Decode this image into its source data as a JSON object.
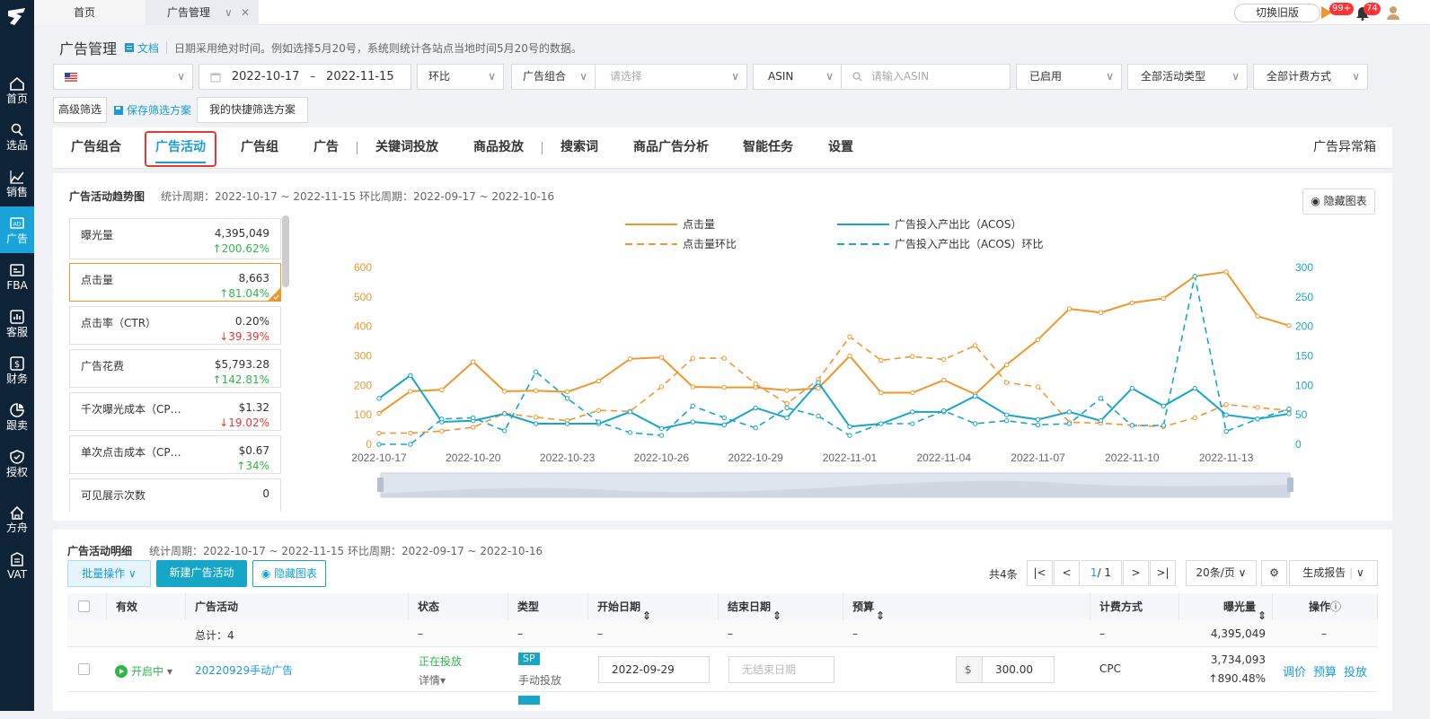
{
  "nav": {
    "items": [
      {
        "label": "首页",
        "icon": "home-icon"
      },
      {
        "label": "选品",
        "icon": "search-icon"
      },
      {
        "label": "销售",
        "icon": "trend-icon"
      },
      {
        "label": "广告",
        "icon": "ad-icon"
      },
      {
        "label": "FBA",
        "icon": "fba-icon"
      },
      {
        "label": "客服",
        "icon": "chart-icon"
      },
      {
        "label": "财务",
        "icon": "dollar-icon"
      },
      {
        "label": "跟卖",
        "icon": "pie-icon"
      },
      {
        "label": "授权",
        "icon": "shield-icon"
      },
      {
        "label": "方舟",
        "icon": "ark-icon"
      },
      {
        "label": "VAT",
        "icon": "vat-icon"
      }
    ]
  },
  "topbar": {
    "home_tab": "首页",
    "current_tab": "广告管理",
    "switch_label": "切换旧版",
    "flag_badge": "99+",
    "bell_badge": "74"
  },
  "header": {
    "title": "广告管理",
    "doc_label": "文档",
    "hint": "日期采用绝对时间。例如选择5月20号，系统则统计各站点当地时间5月20号的数据。"
  },
  "filters": {
    "date_start": "2022-10-17",
    "date_sep": "–",
    "date_end": "2022-11-15",
    "compare": "环比",
    "group_label": "广告组合",
    "group_placeholder": "请选择",
    "asin_label": "ASIN",
    "asin_placeholder": "请输入ASIN",
    "status": "已启用",
    "activity_type": "全部活动类型",
    "billing_type": "全部计费方式",
    "advanced": "高级筛选",
    "save_scheme": "保存筛选方案",
    "my_schemes": "我的快捷筛选方案"
  },
  "tabs": [
    "广告组合",
    "广告活动",
    "广告组",
    "广告",
    "关键词投放",
    "商品投放",
    "搜索词",
    "商品广告分析",
    "智能任务",
    "设置"
  ],
  "anomaly_box": "广告异常箱",
  "trend": {
    "title": "广告活动趋势图",
    "period": "统计周期：2022-10-17 ~ 2022-11-15 环比周期：2022-09-17 ~ 2022-10-16",
    "hide_chart": "隐藏图表"
  },
  "metrics": [
    {
      "label": "曝光量",
      "value": "4,395,049",
      "change": "200.62%",
      "dir": "up"
    },
    {
      "label": "点击量",
      "value": "8,663",
      "change": "81.04%",
      "dir": "up"
    },
    {
      "label": "点击率（CTR）",
      "value": "0.20%",
      "change": "39.39%",
      "dir": "down"
    },
    {
      "label": "广告花费",
      "value": "$5,793.28",
      "change": "142.81%",
      "dir": "up"
    },
    {
      "label": "千次曝光成本（CP…",
      "value": "$1.32",
      "change": "19.02%",
      "dir": "down"
    },
    {
      "label": "单次点击成本（CP…",
      "value": "$0.67",
      "change": "34%",
      "dir": "up"
    },
    {
      "label": "可见展示次数",
      "value": "0",
      "change": "",
      "dir": "up"
    }
  ],
  "chart_data": {
    "type": "line",
    "x": [
      "2022-10-17",
      "2022-10-18",
      "2022-10-19",
      "2022-10-20",
      "2022-10-21",
      "2022-10-22",
      "2022-10-23",
      "2022-10-24",
      "2022-10-25",
      "2022-10-26",
      "2022-10-27",
      "2022-10-28",
      "2022-10-29",
      "2022-10-30",
      "2022-10-31",
      "2022-11-01",
      "2022-11-02",
      "2022-11-03",
      "2022-11-04",
      "2022-11-05",
      "2022-11-06",
      "2022-11-07",
      "2022-11-08",
      "2022-11-09",
      "2022-11-10",
      "2022-11-11",
      "2022-11-12",
      "2022-11-13",
      "2022-11-14",
      "2022-11-15"
    ],
    "xticks": [
      "2022-10-17",
      "2022-10-20",
      "2022-10-23",
      "2022-10-26",
      "2022-10-29",
      "2022-11-01",
      "2022-11-04",
      "2022-11-07",
      "2022-11-10",
      "2022-11-13"
    ],
    "y_left": {
      "ticks": [
        0,
        100,
        200,
        300,
        400,
        500,
        600
      ],
      "ylim": [
        0,
        600
      ],
      "color": "#f0962a"
    },
    "y_right": {
      "ticks": [
        0,
        50,
        100,
        150,
        200,
        250,
        300
      ],
      "ylim": [
        0,
        300
      ],
      "color": "#16a6c8"
    },
    "series": [
      {
        "name": "点击量",
        "axis": "left",
        "style": "solid",
        "color": "#f0962a",
        "values": [
          105,
          180,
          185,
          280,
          180,
          182,
          178,
          215,
          290,
          295,
          195,
          193,
          193,
          183,
          190,
          300,
          175,
          175,
          218,
          170,
          270,
          355,
          460,
          447,
          480,
          495,
          570,
          585,
          435,
          403
        ]
      },
      {
        "name": "点击量环比",
        "axis": "left",
        "style": "dashed",
        "color": "#f0962a",
        "values": [
          38,
          38,
          45,
          58,
          105,
          92,
          80,
          115,
          112,
          195,
          292,
          292,
          205,
          138,
          220,
          365,
          285,
          298,
          288,
          335,
          210,
          195,
          75,
          72,
          65,
          60,
          90,
          135,
          125,
          115
        ]
      },
      {
        "name": "广告投入产出比（ACOS）",
        "axis": "right",
        "style": "solid",
        "color": "#16a6c8",
        "values": [
          78,
          117,
          38,
          40,
          52,
          35,
          35,
          35,
          55,
          27,
          38,
          33,
          62,
          45,
          105,
          30,
          35,
          55,
          55,
          82,
          50,
          42,
          55,
          40,
          95,
          65,
          95,
          50,
          43,
          52
        ]
      },
      {
        "name": "广告投入产出比（ACOS）环比",
        "axis": "right",
        "style": "dashed",
        "color": "#16a6c8",
        "values": [
          0,
          0,
          43,
          45,
          23,
          123,
          78,
          38,
          20,
          15,
          65,
          45,
          28,
          62,
          48,
          15,
          35,
          35,
          57,
          35,
          40,
          33,
          35,
          78,
          32,
          32,
          285,
          22,
          43,
          60
        ]
      }
    ]
  },
  "detail": {
    "title": "广告活动明细",
    "period": "统计周期：2022-10-17 ~ 2022-11-15 环比周期：2022-09-17 ~ 2022-10-16",
    "batch": "批量操作",
    "new_campaign": "新建广告活动",
    "hide_chart": "隐藏图表",
    "total_count": "共4条",
    "page_current": "1",
    "page_total": "/ 1",
    "page_size": "20条/页",
    "report": "生成报告",
    "columns": [
      "有效",
      "广告活动",
      "状态",
      "类型",
      "开始日期",
      "结束日期",
      "预算",
      "计费方式",
      "曝光量",
      "操作"
    ],
    "summary": {
      "label": "总计：4",
      "dash": "–",
      "impressions": "4,395,049"
    },
    "row1": {
      "valid": "开启中",
      "name": "20220929手动广告",
      "status": "正在投放",
      "detail_link": "详情",
      "type_badge": "SP",
      "type_text": "手动投放",
      "start_date": "2022-09-29",
      "end_placeholder": "无结束日期",
      "currency": "$",
      "budget": "300.00",
      "billing": "CPC",
      "impressions": "3,734,093",
      "impressions_change": "890.48%",
      "ops": [
        "调价",
        "预算",
        "投放"
      ]
    }
  }
}
